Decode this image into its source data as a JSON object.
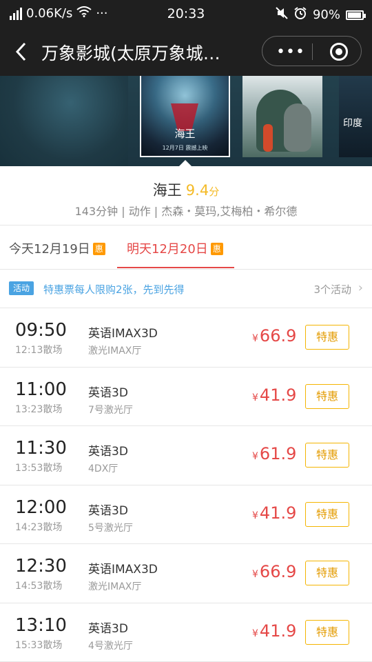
{
  "status_bar": {
    "speed": "0.06K/s",
    "dots": "···",
    "time": "20:33",
    "battery": "90%"
  },
  "nav": {
    "back_icon": "chevron-left-icon",
    "title": "万象影城(太原万象城…",
    "more_icon": "more-dots-icon",
    "close_icon": "target-close-icon"
  },
  "posters": {
    "main_title": "海王",
    "main_footer": "12月7日 震撼上映",
    "side_title": "印度"
  },
  "movie": {
    "title": "海王",
    "score": "9.4",
    "score_unit": "分",
    "meta": "143分钟 | 动作 | 杰森・莫玛,艾梅柏・希尔德"
  },
  "date_tabs": [
    {
      "label": "今天12月19日",
      "badge": "惠",
      "active": false
    },
    {
      "label": "明天12月20日",
      "badge": "惠",
      "active": true
    }
  ],
  "activity": {
    "tag": "活动",
    "text": "特惠票每人限购2张，先到先得",
    "count": "3个活动",
    "chevron": "›"
  },
  "showtimes": [
    {
      "start": "09:50",
      "end": "12:13散场",
      "lang": "英语IMAX3D",
      "hall": "激光IMAX厅",
      "yen": "¥",
      "price": "66.9",
      "btn": "特惠"
    },
    {
      "start": "11:00",
      "end": "13:23散场",
      "lang": "英语3D",
      "hall": "7号激光厅",
      "yen": "¥",
      "price": "41.9",
      "btn": "特惠"
    },
    {
      "start": "11:30",
      "end": "13:53散场",
      "lang": "英语3D",
      "hall": "4DX厅",
      "yen": "¥",
      "price": "61.9",
      "btn": "特惠"
    },
    {
      "start": "12:00",
      "end": "14:23散场",
      "lang": "英语3D",
      "hall": "5号激光厅",
      "yen": "¥",
      "price": "41.9",
      "btn": "特惠"
    },
    {
      "start": "12:30",
      "end": "14:53散场",
      "lang": "英语IMAX3D",
      "hall": "激光IMAX厅",
      "yen": "¥",
      "price": "66.9",
      "btn": "特惠"
    },
    {
      "start": "13:10",
      "end": "15:33散场",
      "lang": "英语3D",
      "hall": "4号激光厅",
      "yen": "¥",
      "price": "41.9",
      "btn": "特惠"
    }
  ]
}
